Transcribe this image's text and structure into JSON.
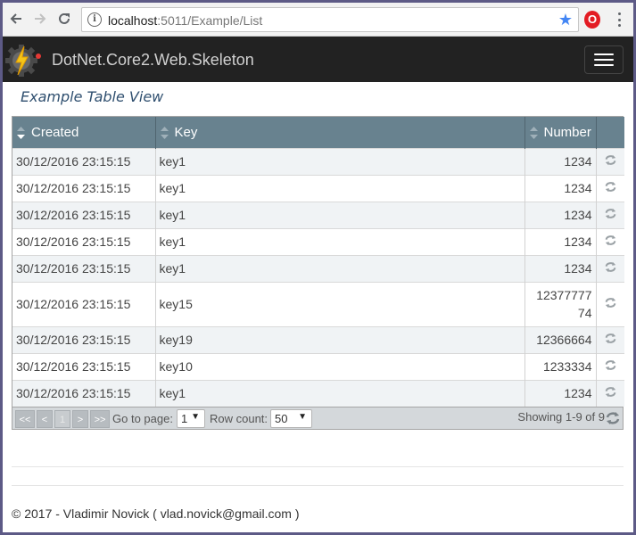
{
  "browser": {
    "url_host": "localhost",
    "url_rest": ":5011/Example/List",
    "back_icon": "arrow-left-icon",
    "forward_icon": "arrow-right-icon",
    "reload_icon": "reload-icon",
    "info_icon": "info-icon",
    "bookmark_icon": "star-icon",
    "extension_icon": "opera-icon",
    "menu_icon": "kebab-menu-icon"
  },
  "navbar": {
    "brand": "DotNet.Core2.Web.Skeleton",
    "logo_icon": "gear-lightning-icon",
    "toggle_icon": "hamburger-icon"
  },
  "page": {
    "title": "Example Table View"
  },
  "table": {
    "columns": [
      {
        "label": "Created"
      },
      {
        "label": "Key"
      },
      {
        "label": "Number"
      }
    ],
    "rows": [
      {
        "created": "30/12/2016 23:15:15",
        "key": "key1",
        "number": "1234"
      },
      {
        "created": "30/12/2016 23:15:15",
        "key": "key1",
        "number": "1234"
      },
      {
        "created": "30/12/2016 23:15:15",
        "key": "key1",
        "number": "1234"
      },
      {
        "created": "30/12/2016 23:15:15",
        "key": "key1",
        "number": "1234"
      },
      {
        "created": "30/12/2016 23:15:15",
        "key": "key1",
        "number": "1234"
      },
      {
        "created": "30/12/2016 23:15:15",
        "key": "key15",
        "number": "12377777 74"
      },
      {
        "created": "30/12/2016 23:15:15",
        "key": "key19",
        "number": "12366664"
      },
      {
        "created": "30/12/2016 23:15:15",
        "key": "key10",
        "number": "1233334"
      },
      {
        "created": "30/12/2016 23:15:15",
        "key": "key1",
        "number": "1234"
      }
    ],
    "row_action_icon": "refresh-icon"
  },
  "pager": {
    "first": "<<",
    "prev": "<",
    "current": "1",
    "next": ">",
    "last": ">>",
    "goto_label": "Go to page:",
    "goto_value": "1",
    "rowcount_label": "Row count:",
    "rowcount_value": "50",
    "showing": "Showing 1-9 of 9",
    "refresh_icon": "refresh-icon"
  },
  "footer": {
    "text": "© 2017 - Vladimir Novick ( vlad.novick@gmail.com )"
  },
  "colors": {
    "header_bg": "#68828f",
    "navbar_bg": "#222222",
    "title_color": "#2f4f6f"
  }
}
